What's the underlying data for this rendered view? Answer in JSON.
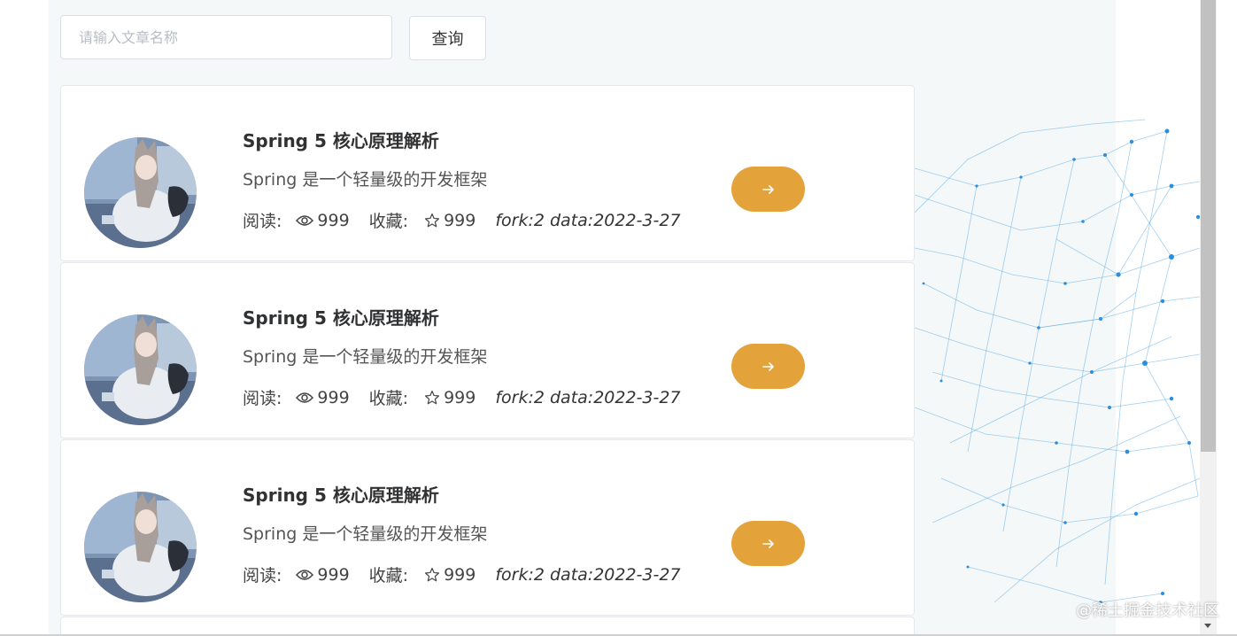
{
  "search": {
    "placeholder": "请输入文章名称",
    "value": "",
    "button_label": "查询"
  },
  "articles": [
    {
      "title": "Spring 5 核心原理解析",
      "description": "Spring 是一个轻量级的开发框架",
      "read_label": "阅读:",
      "read_count": "999",
      "fav_label": "收藏:",
      "fav_count": "999",
      "extra": "fork:2 data:2022-3-27"
    },
    {
      "title": "Spring 5 核心原理解析",
      "description": "Spring 是一个轻量级的开发框架",
      "read_label": "阅读:",
      "read_count": "999",
      "fav_label": "收藏:",
      "fav_count": "999",
      "extra": "fork:2 data:2022-3-27"
    },
    {
      "title": "Spring 5 核心原理解析",
      "description": "Spring 是一个轻量级的开发框架",
      "read_label": "阅读:",
      "read_count": "999",
      "fav_label": "收藏:",
      "fav_count": "999",
      "extra": "fork:2 data:2022-3-27"
    }
  ],
  "icons": {
    "read": "eye-icon",
    "favorite": "star-icon",
    "go": "arrow-right-icon"
  },
  "colors": {
    "accent": "#e4a23a",
    "panel_bg": "#f4f8f8",
    "network": "#2a8fe0"
  },
  "watermark": "@稀土掘金技术社区"
}
